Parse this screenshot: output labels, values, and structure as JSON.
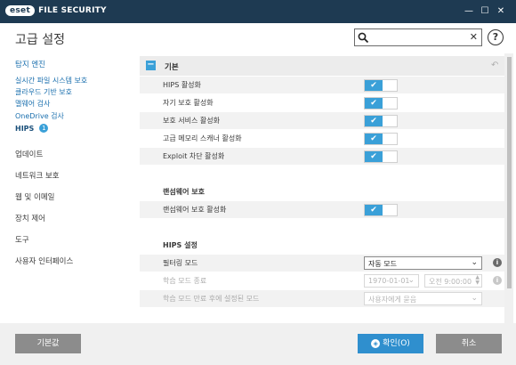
{
  "app": {
    "logo_text": "eset",
    "product_title": "FILE SECURITY"
  },
  "window_controls": {
    "minimize": "—",
    "maximize": "☐",
    "close": "✕"
  },
  "header": {
    "title": "고급 설정",
    "search": {
      "value": "",
      "placeholder": ""
    },
    "clear_glyph": "✕",
    "help_glyph": "?"
  },
  "sidebar": {
    "categories": [
      {
        "label": "탐지 엔진",
        "active": true
      },
      {
        "label": "업데이트"
      },
      {
        "label": "네트워크 보호"
      },
      {
        "label": "웹 및 이메일"
      },
      {
        "label": "장치 제어"
      },
      {
        "label": "도구"
      },
      {
        "label": "사용자 인터페이스"
      }
    ],
    "sub_items": [
      {
        "label": "실시간 파일 시스템 보호"
      },
      {
        "label": "클라우드 기반 보호"
      },
      {
        "label": "맬웨어 검사"
      },
      {
        "label": "OneDrive 검사"
      },
      {
        "label": "HIPS",
        "selected": true,
        "badge": "1"
      }
    ]
  },
  "content": {
    "section": {
      "title": "기본",
      "collapse_glyph": "−",
      "revert_glyph": "↶"
    },
    "basic_toggles": [
      {
        "label": "HIPS 활성화",
        "enabled": true
      },
      {
        "label": "자기 보호 활성화",
        "enabled": true
      },
      {
        "label": "보호 서비스 활성화",
        "enabled": true
      },
      {
        "label": "고급 메모리 스캐너 활성화",
        "enabled": true
      },
      {
        "label": "Exploit 차단 활성화",
        "enabled": true
      }
    ],
    "ransomware": {
      "heading": "랜섬웨어 보호",
      "toggle": {
        "label": "랜섬웨어 보호 활성화",
        "enabled": true
      }
    },
    "hips_settings": {
      "heading": "HIPS 설정",
      "filter_mode": {
        "label": "필터링 모드",
        "value": "자동 모드"
      },
      "learning_end": {
        "label": "학습 모드 종료",
        "date": "1970-01-01",
        "time": "오전 9:00:00"
      },
      "learning_after": {
        "label": "학습 모드 만료 후에 설정된 모드",
        "value": "사용자에게 묻음"
      }
    }
  },
  "footer": {
    "default_label": "기본값",
    "ok_label": "확인(O)",
    "cancel_label": "취소"
  },
  "colors": {
    "titlebar": "#1e3a52",
    "accent": "#3aa0d8",
    "link": "#1a6fae",
    "button_gray": "#8c8c8c",
    "button_blue": "#2f8fce"
  }
}
